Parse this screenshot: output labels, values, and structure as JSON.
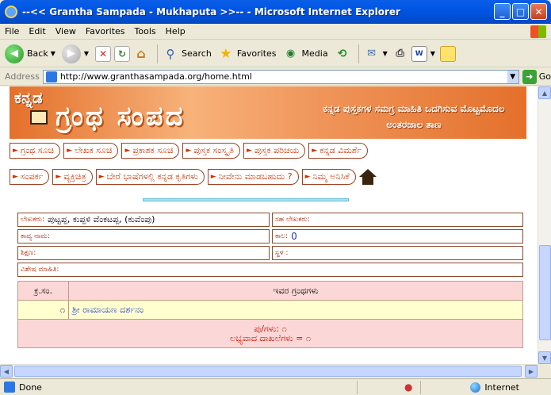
{
  "window": {
    "title": "--<< Grantha Sampada - Mukhaputa >>-- - Microsoft Internet Explorer",
    "minimize": "_",
    "maximize": "□",
    "close": "✕"
  },
  "menu": [
    "File",
    "Edit",
    "View",
    "Favorites",
    "Tools",
    "Help"
  ],
  "toolbar": {
    "back": "Back",
    "search": "Search",
    "favorites": "Favorites",
    "media": "Media"
  },
  "address": {
    "label": "Address",
    "url": "http://www.granthasampada.org/home.html",
    "go": "Go"
  },
  "banner": {
    "logo_small": "ಕನ್ನಡ",
    "logo_big": "ಗ್ರಂಥ ಸಂಪದ",
    "tagline": "ಕನ್ನಡ ಪುಸ್ತಕಗಳ ಸಮಗ್ರ ಮಾಹಿತಿ ಒದಗಿಸುವ ಮೊಟ್ಟಮೊದಲ ಅಂತರಜಾಲ ತಾಣ"
  },
  "nav_row1": [
    "ಗ್ರಂಥ ಸೂಚಿ",
    "ಲೇಖಕ ಸೂಚಿ",
    "ಪ್ರಕಾಶಕ ಸೂಚಿ",
    "ಪುಸ್ತಕ ಸಂಸ್ಕೃತಿ",
    "ಪುಸ್ತಕ ಪರಿಚಯ",
    "ಕನ್ನಡ ವಿಮರ್ಶೆ"
  ],
  "nav_row2": [
    "ಸಂಪರ್ಕ",
    "ವ್ಯಕ್ತಿಚಿತ್ರ",
    "ಬೇರೆ ಭಾಷೆಗಳಲ್ಲಿ ಕನ್ನಡ ಕೃತಿಗಳು",
    "ನೀವೇನು ಮಾಡಬಹುದು ?",
    "ನಿಮ್ಮ ಅನಿಸಿಕೆ"
  ],
  "info": {
    "author_label": "ಲೇಖಕರು:",
    "author_value": "ಪುಟ್ಟಪ್ಪ, ಕುಪ್ಪಳಿ ವೆಂಕಟಪ್ಪ, (ಕುವೆಂಪು)",
    "coauthor_label": "ಸಹ ಲೇಖಕರು:",
    "pen_name_label": "ಕಾವ್ಯ ನಾಮ:",
    "period_label": "ಕಾಲ:",
    "period_value": "0",
    "education_label": "ಶಿಕ್ಷಣ:",
    "native_label": "ಸ್ಥಳ :",
    "special_label": "ವಿಶೇಷ ಮಾಹಿತಿ:"
  },
  "table": {
    "col_no": "ಕ್ರ.ಸಂ.",
    "col_books": "ಇವರ ಗ್ರಂಥಗಳು",
    "rows": [
      {
        "no": "೧",
        "title": "ಶ್ರೀ ರಾಮಾಯಣ ದರ್ಶನಂ"
      }
    ],
    "footer_line1": "ಪು/ಗಳು: ೧",
    "footer_line2": "ಲಭ್ಯವಾದ ದಾಖಲೆಗಳು = ೧"
  },
  "status": {
    "text": "Done",
    "zone": "Internet"
  }
}
